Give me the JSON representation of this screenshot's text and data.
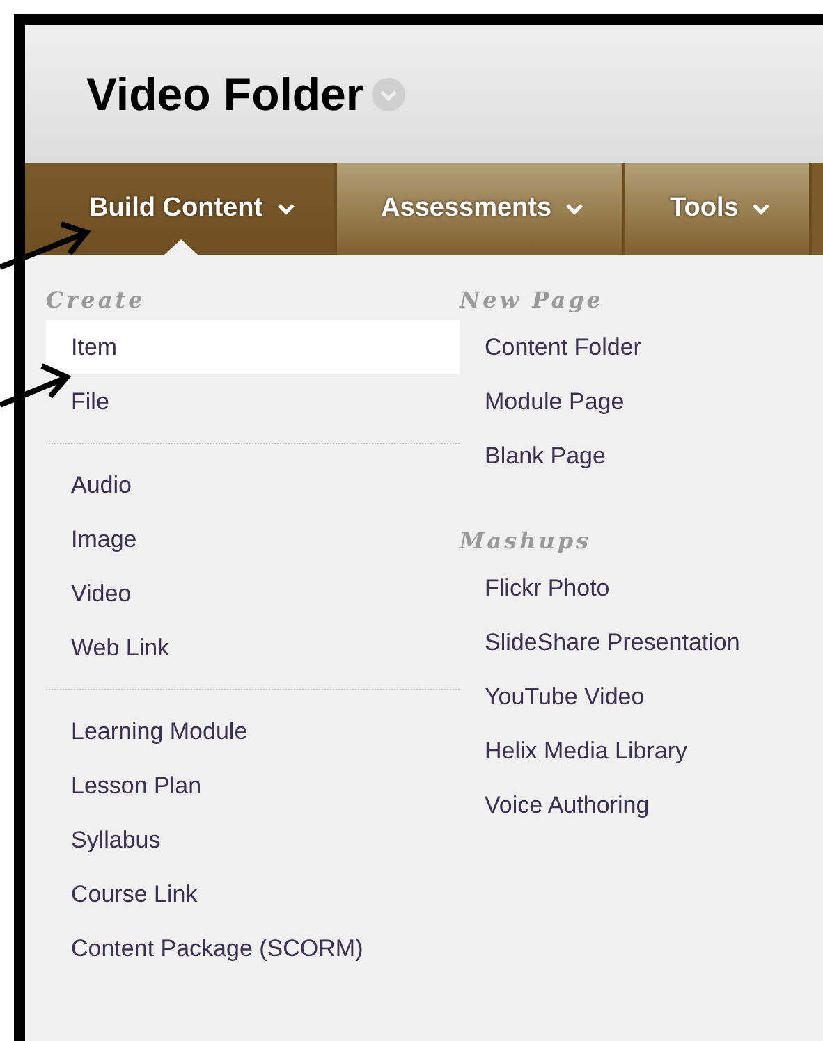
{
  "page": {
    "title": "Video Folder"
  },
  "tabs": [
    {
      "label": "Build Content",
      "selected": true
    },
    {
      "label": "Assessments",
      "selected": false
    },
    {
      "label": "Tools",
      "selected": false
    }
  ],
  "menu": {
    "columns": [
      {
        "sections": [
          {
            "heading": "Create",
            "groups": [
              [
                {
                  "label": "Item",
                  "selected": true
                },
                {
                  "label": "File",
                  "selected": false
                }
              ],
              [
                {
                  "label": "Audio",
                  "selected": false
                },
                {
                  "label": "Image",
                  "selected": false
                },
                {
                  "label": "Video",
                  "selected": false
                },
                {
                  "label": "Web Link",
                  "selected": false
                }
              ],
              [
                {
                  "label": "Learning Module",
                  "selected": false
                },
                {
                  "label": "Lesson Plan",
                  "selected": false
                },
                {
                  "label": "Syllabus",
                  "selected": false
                },
                {
                  "label": "Course Link",
                  "selected": false
                },
                {
                  "label": "Content Package (SCORM)",
                  "selected": false
                }
              ]
            ]
          }
        ]
      },
      {
        "sections": [
          {
            "heading": "New Page",
            "groups": [
              [
                {
                  "label": "Content Folder",
                  "selected": false
                },
                {
                  "label": "Module Page",
                  "selected": false
                },
                {
                  "label": "Blank Page",
                  "selected": false
                }
              ]
            ]
          },
          {
            "heading": "Mashups",
            "groups": [
              [
                {
                  "label": "Flickr Photo",
                  "selected": false
                },
                {
                  "label": "SlideShare Presentation",
                  "selected": false
                },
                {
                  "label": "YouTube Video",
                  "selected": false
                },
                {
                  "label": "Helix Media Library",
                  "selected": false
                },
                {
                  "label": "Voice Authoring",
                  "selected": false
                }
              ]
            ]
          }
        ]
      }
    ]
  }
}
